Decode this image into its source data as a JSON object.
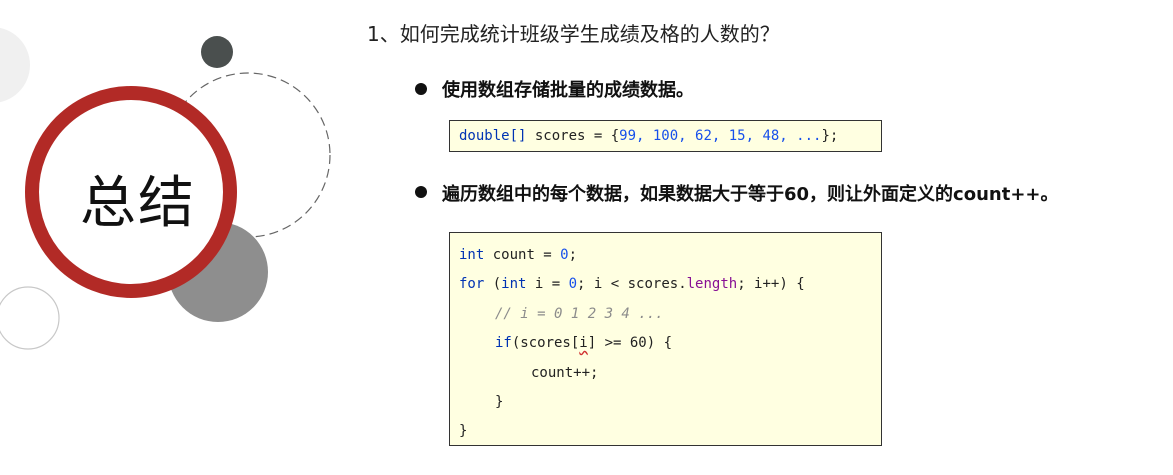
{
  "slide": {
    "title": "总结",
    "question": "1、如何完成统计班级学生成绩及格的人数的？",
    "points": [
      {
        "text": "使用数组存储批量的成绩数据。",
        "code_line": {
          "type": "double[]",
          "plain": " scores = {",
          "values": "99, 100, 62, 15, 48, ...",
          "end": "};"
        }
      },
      {
        "text": "遍历数组中的每个数据，如果数据大于等于60，则让外面定义的count++。",
        "code": {
          "l1_kw": "int",
          "l1_rest": " count = ",
          "l1_num": "0",
          "l1_end": ";",
          "l2_kw": "for",
          "l2_a": " (",
          "l2_kw2": "int",
          "l2_b": " i = ",
          "l2_num": "0",
          "l2_c": "; i < scores.",
          "l2_prop": "length",
          "l2_d": "; i++) {",
          "l3_comment": "// i = 0 1 2 3 4 ...",
          "l4_kw": "if",
          "l4_a": "(scores[",
          "l4_idx": "i",
          "l4_b": "] >= 60) {",
          "l5": "count++;",
          "l6": "}",
          "l7": "}"
        }
      }
    ]
  },
  "colors": {
    "ring": "#b22a26",
    "dark_dot": "#4a4f4e",
    "gray_circle": "#8e8e8e",
    "code_bg": "#ffffe1",
    "keyword": "#0033b3"
  }
}
